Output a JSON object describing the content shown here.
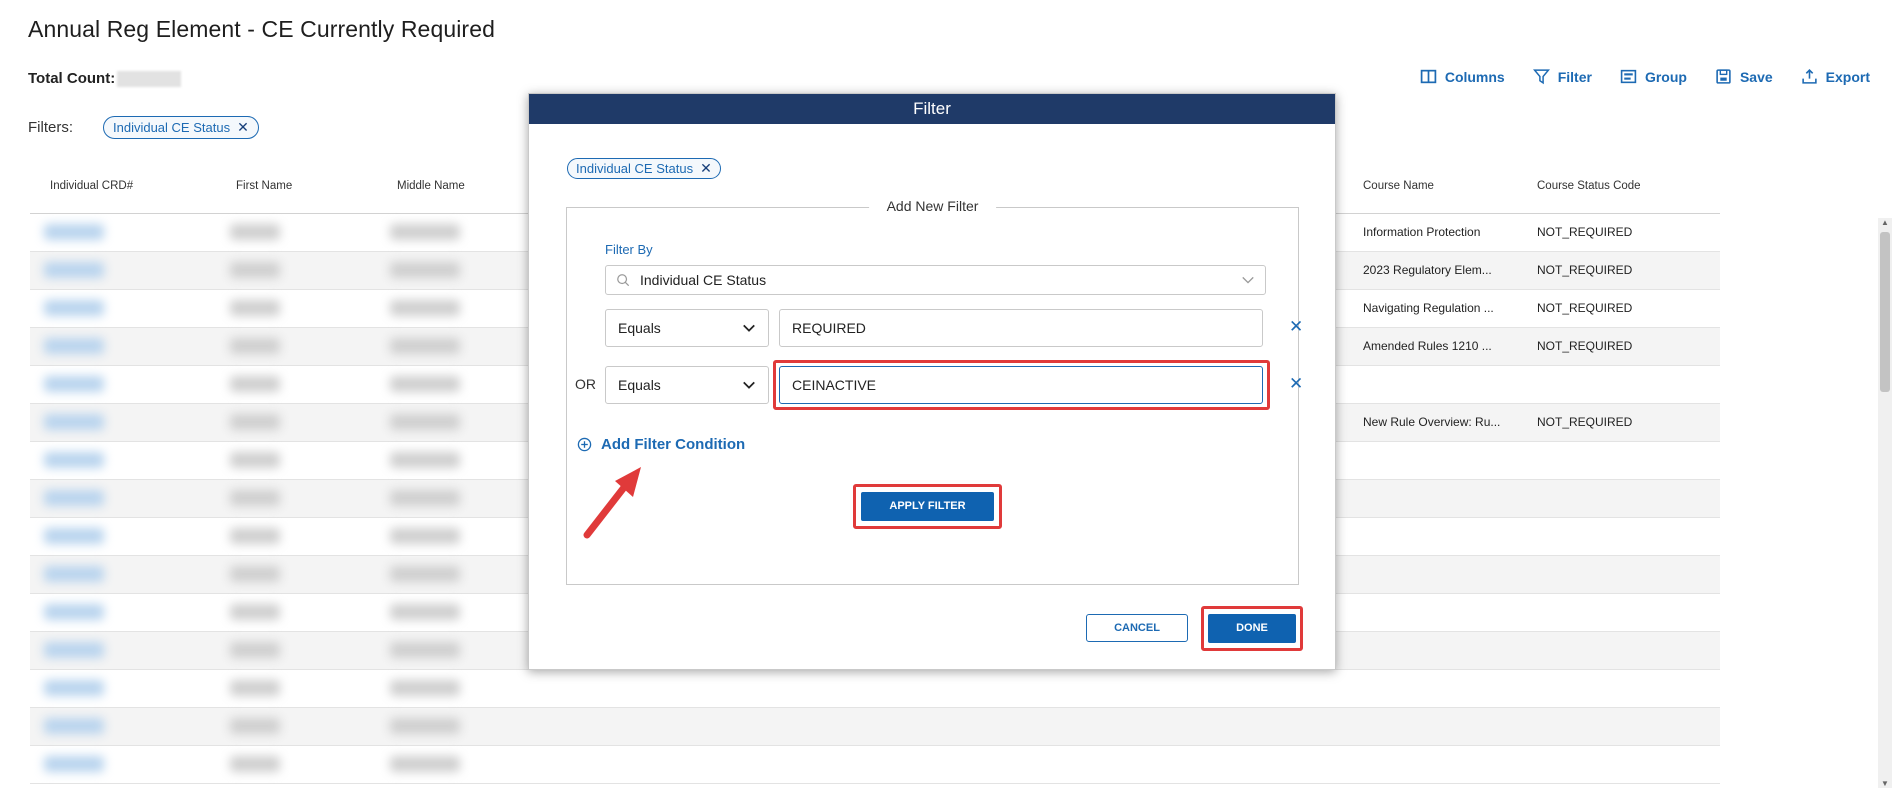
{
  "page": {
    "title": "Annual Reg Element - CE Currently Required",
    "total_count_label": "Total Count:",
    "filters_label": "Filters:",
    "active_filter_chip": "Individual CE Status",
    "chip_remove": "✕"
  },
  "toolbar": {
    "columns": "Columns",
    "filter": "Filter",
    "group": "Group",
    "save": "Save",
    "export": "Export"
  },
  "grid": {
    "columns": [
      "Individual CRD#",
      "First Name",
      "Middle Name",
      "Course Name",
      "Course Status Code"
    ],
    "rows": [
      {
        "course_name": "Information Protection",
        "status": "NOT_REQUIRED"
      },
      {
        "course_name": "2023 Regulatory Elem...",
        "status": "NOT_REQUIRED"
      },
      {
        "course_name": "Navigating Regulation ...",
        "status": "NOT_REQUIRED"
      },
      {
        "course_name": "Amended Rules 1210 ...",
        "status": "NOT_REQUIRED"
      },
      {
        "course_name": "",
        "status": ""
      },
      {
        "course_name": "New Rule Overview: Ru...",
        "status": "NOT_REQUIRED"
      },
      {
        "course_name": "",
        "status": ""
      },
      {
        "course_name": "",
        "status": ""
      },
      {
        "course_name": "",
        "status": ""
      },
      {
        "course_name": "",
        "status": ""
      },
      {
        "course_name": "",
        "status": ""
      },
      {
        "course_name": "",
        "status": ""
      },
      {
        "course_name": "",
        "status": ""
      },
      {
        "course_name": "",
        "status": ""
      },
      {
        "course_name": "",
        "status": ""
      }
    ]
  },
  "modal": {
    "title": "Filter",
    "chip": "Individual CE Status",
    "chip_remove": "✕",
    "section_legend": "Add New Filter",
    "filter_by_label": "Filter By",
    "filter_by_value": "Individual CE Status",
    "conditions": [
      {
        "connector": "",
        "operator": "Equals",
        "value": "REQUIRED"
      },
      {
        "connector": "OR",
        "operator": "Equals",
        "value": "CEINACTIVE"
      }
    ],
    "remove_condition": "✕",
    "add_condition_label": "Add Filter Condition",
    "apply_label": "APPLY FILTER",
    "cancel_label": "CANCEL",
    "done_label": "DONE"
  },
  "colors": {
    "brand_blue": "#1d6ab3",
    "header_navy": "#1f3a68",
    "primary_button": "#0f62b0",
    "annotation_red": "#e03a3a"
  },
  "icons": [
    "columns-icon",
    "filter-icon",
    "group-icon",
    "save-icon",
    "export-icon",
    "search-icon",
    "chevron-down-icon",
    "plus-circle-icon",
    "close-icon"
  ]
}
